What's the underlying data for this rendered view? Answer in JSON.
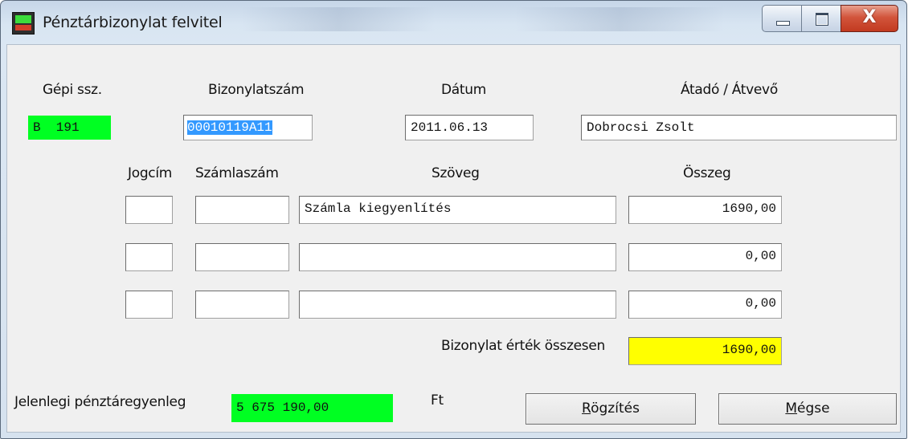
{
  "window": {
    "title": "Pénztárbizonylat felvitel",
    "close_glyph": "X"
  },
  "header": {
    "gepi_ssz_label": "Gépi ssz.",
    "gepi_ssz_value": "B  191",
    "bizonylatszam_label": "Bizonylatszám",
    "bizonylatszam_value": "00010119A11",
    "datum_label": "Dátum",
    "datum_value": "2011.06.13",
    "atado_label": "Átadó / Átvevő",
    "atado_value": "Dobrocsi Zsolt"
  },
  "columns": {
    "jogcim": "Jogcím",
    "szamlaszam": "Számlaszám",
    "szoveg": "Szöveg",
    "osszeg": "Összeg"
  },
  "rows": [
    {
      "jogcim": "",
      "szamlaszam": "",
      "szoveg": "Számla kiegyenlítés",
      "osszeg": "1690,00"
    },
    {
      "jogcim": "",
      "szamlaszam": "",
      "szoveg": "",
      "osszeg": "0,00"
    },
    {
      "jogcim": "",
      "szamlaszam": "",
      "szoveg": "",
      "osszeg": "0,00"
    }
  ],
  "total": {
    "label": "Bizonylat érték összesen",
    "value": "1690,00"
  },
  "balance": {
    "label": "Jelenlegi pénztáregyenleg",
    "value": "5 675 190,00",
    "unit": "Ft"
  },
  "buttons": {
    "save_first": "R",
    "save_rest": "ögzítés",
    "cancel_first": "M",
    "cancel_rest": "égse"
  },
  "colors": {
    "green_field": "#00ff22",
    "total_field": "#ffff00",
    "selection": "#3399ff"
  },
  "icons": {
    "app": "app-icon",
    "minimize": "minimize-icon",
    "maximize": "maximize-icon",
    "close": "close-icon"
  }
}
